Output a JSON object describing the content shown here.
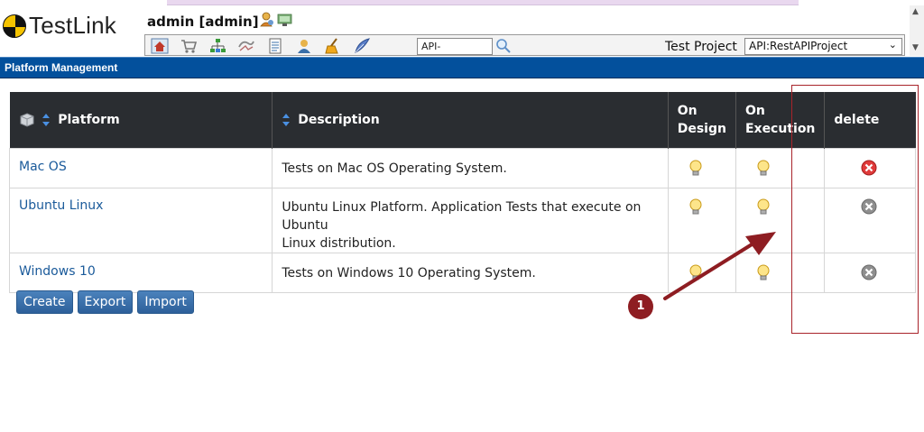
{
  "app": {
    "logo_text": "TestLink"
  },
  "header": {
    "user": "admin [admin]",
    "tc_search_value": "API-",
    "test_project_label": "Test Project",
    "test_project_value": "API:RestAPIProject"
  },
  "toolbar_icons": [
    "home-icon",
    "cart-icon",
    "tree-icon",
    "execute-icon",
    "document-icon",
    "user-icon",
    "broom-icon",
    "feather-icon"
  ],
  "section": {
    "title": "Platform Management"
  },
  "table": {
    "headers": {
      "platform": "Platform",
      "description": "Description",
      "on_design_line1": "On",
      "on_design_line2": "Design",
      "on_execution_line1": "On",
      "on_execution_line2": "Execution",
      "delete": "delete"
    },
    "rows": [
      {
        "platform": "Mac OS",
        "description": "Tests on Mac OS Operating System.",
        "delete_state": "active"
      },
      {
        "platform": "Ubuntu Linux",
        "description_line1": "Ubuntu Linux Platform. Application Tests that execute on Ubuntu",
        "description_line2": "Linux distribution.",
        "delete_state": "disabled"
      },
      {
        "platform": "Windows 10",
        "description": "Tests on Windows 10 Operating System.",
        "delete_state": "disabled"
      }
    ]
  },
  "buttons": {
    "create": "Create",
    "export": "Export",
    "import": "Import"
  },
  "annotation": {
    "badge": "1"
  },
  "colors": {
    "section_bar": "#03509c",
    "table_header": "#2a2d31",
    "button": "#3a6fa8",
    "annotation": "#a8232a",
    "link": "#1a5a9a"
  }
}
